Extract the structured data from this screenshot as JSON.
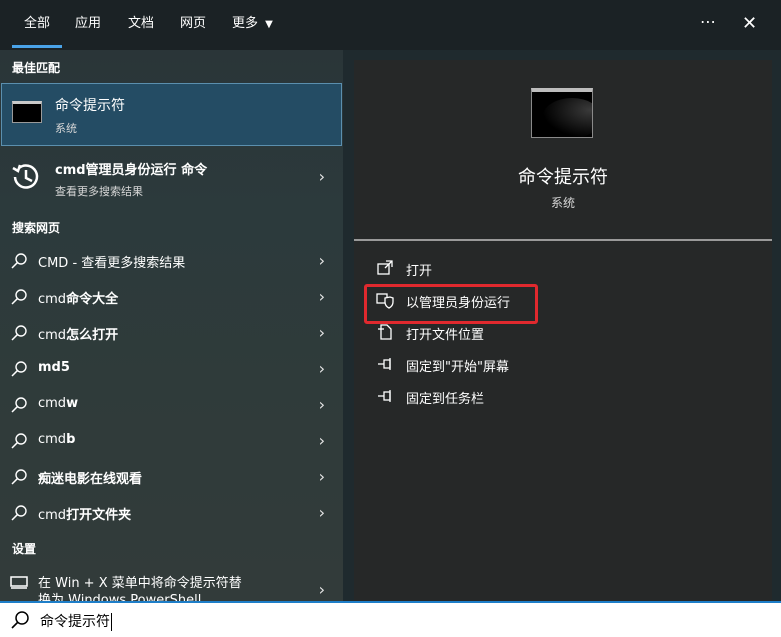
{
  "tabs": [
    {
      "label": "全部",
      "active": true
    },
    {
      "label": "应用"
    },
    {
      "label": "文档"
    },
    {
      "label": "网页"
    },
    {
      "label": "更多"
    }
  ],
  "top_icons": {
    "more": "⋯",
    "close": "✕"
  },
  "sections": {
    "best_match": "最佳匹配",
    "web": "搜索网页",
    "settings": "设置"
  },
  "best_match": {
    "title": "命令提示符",
    "subtitle": "系统"
  },
  "history_item": {
    "title": "cmd管理员身份运行 命令",
    "subtitle": "查看更多搜索结果"
  },
  "web_results": [
    {
      "prefix": "CMD",
      "suffix": " - 查看更多搜索结果",
      "bold_suffix": false
    },
    {
      "prefix": "cmd",
      "suffix": "命令大全",
      "bold_suffix": true
    },
    {
      "prefix": "cmd",
      "suffix": "怎么打开",
      "bold_suffix": true
    },
    {
      "prefix": "",
      "suffix": "md5",
      "bold_suffix": true
    },
    {
      "prefix": "cmd",
      "suffix": "w",
      "bold_suffix": true
    },
    {
      "prefix": "cmd",
      "suffix": "b",
      "bold_suffix": true
    },
    {
      "prefix": "",
      "suffix": "痴迷电影在线观看",
      "bold_suffix": true
    },
    {
      "prefix": "cmd",
      "suffix": "打开文件夹",
      "bold_suffix": true
    }
  ],
  "settings_item": {
    "line1": "在 Win + X 菜单中将命令提示符替",
    "line2": "换为 Windows PowerShell"
  },
  "preview": {
    "title": "命令提示符",
    "subtitle": "系统"
  },
  "actions": [
    {
      "label": "打开",
      "icon": "open-icon"
    },
    {
      "label": "以管理员身份运行",
      "icon": "shield-icon"
    },
    {
      "label": "打开文件位置",
      "icon": "folder-location-icon"
    },
    {
      "label": "固定到\"开始\"屏幕",
      "icon": "pin-icon"
    },
    {
      "label": "固定到任务栏",
      "icon": "pin-icon"
    }
  ],
  "search": {
    "value": "命令提示符"
  },
  "colors": {
    "accent": "#4aa3e8",
    "highlight": "#e0292e",
    "selected_bg": "#244c64"
  }
}
